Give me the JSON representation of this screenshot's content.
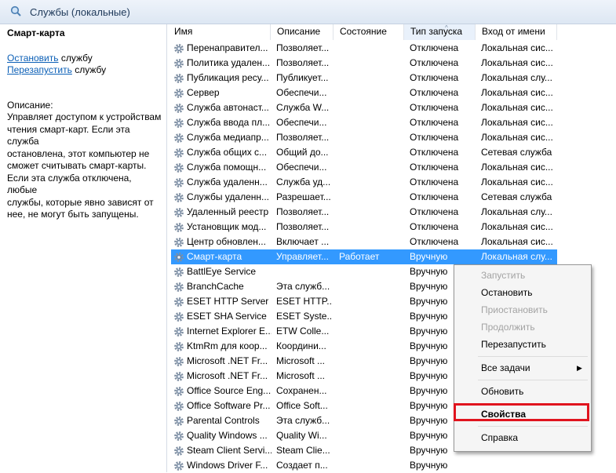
{
  "header": {
    "title": "Службы (локальные)",
    "icon": "services-magnifier-icon"
  },
  "leftpane": {
    "selected_service": "Смарт-карта",
    "stop_link": "Остановить",
    "stop_suffix": "службу",
    "restart_link": "Перезапустить",
    "restart_suffix": "службу",
    "description_label": "Описание:",
    "description_lines": [
      "Управляет доступом к устройствам",
      "чтения смарт-карт. Если эта служба",
      "остановлена, этот компьютер не",
      "сможет считывать смарт-карты.",
      "Если эта служба отключена, любые",
      "службы, которые явно зависят от",
      "нее, не могут быть запущены."
    ]
  },
  "columns": {
    "name": "Имя",
    "description": "Описание",
    "state": "Состояние",
    "startup": "Тип запуска",
    "logon": "Вход от имени"
  },
  "rows": [
    {
      "name": "Перенаправител...",
      "desc": "Позволяет...",
      "state": "",
      "start": "Отключена",
      "logon": "Локальная сис..."
    },
    {
      "name": "Политика удален...",
      "desc": "Позволяет...",
      "state": "",
      "start": "Отключена",
      "logon": "Локальная сис..."
    },
    {
      "name": "Публикация ресу...",
      "desc": "Публикует...",
      "state": "",
      "start": "Отключена",
      "logon": "Локальная слу..."
    },
    {
      "name": "Сервер",
      "desc": "Обеспечи...",
      "state": "",
      "start": "Отключена",
      "logon": "Локальная сис..."
    },
    {
      "name": "Служба автонаст...",
      "desc": "Служба W...",
      "state": "",
      "start": "Отключена",
      "logon": "Локальная сис..."
    },
    {
      "name": "Служба ввода пл...",
      "desc": "Обеспечи...",
      "state": "",
      "start": "Отключена",
      "logon": "Локальная сис..."
    },
    {
      "name": "Служба медиапр...",
      "desc": "Позволяет...",
      "state": "",
      "start": "Отключена",
      "logon": "Локальная сис..."
    },
    {
      "name": "Служба общих с...",
      "desc": "Общий до...",
      "state": "",
      "start": "Отключена",
      "logon": "Сетевая служба"
    },
    {
      "name": "Служба помощн...",
      "desc": "Обеспечи...",
      "state": "",
      "start": "Отключена",
      "logon": "Локальная сис..."
    },
    {
      "name": "Служба удаленн...",
      "desc": "Служба уд...",
      "state": "",
      "start": "Отключена",
      "logon": "Локальная сис..."
    },
    {
      "name": "Службы удаленн...",
      "desc": "Разрешает...",
      "state": "",
      "start": "Отключена",
      "logon": "Сетевая служба"
    },
    {
      "name": "Удаленный реестр",
      "desc": "Позволяет...",
      "state": "",
      "start": "Отключена",
      "logon": "Локальная слу..."
    },
    {
      "name": "Установщик мод...",
      "desc": "Позволяет...",
      "state": "",
      "start": "Отключена",
      "logon": "Локальная сис..."
    },
    {
      "name": "Центр обновлен...",
      "desc": "Включает ...",
      "state": "",
      "start": "Отключена",
      "logon": "Локальная сис..."
    },
    {
      "name": "Смарт-карта",
      "desc": "Управляет...",
      "state": "Работает",
      "start": "Вручную",
      "logon": "Локальная слу...",
      "selected": true
    },
    {
      "name": "BattlEye Service",
      "desc": "",
      "state": "",
      "start": "Вручную",
      "logon": ""
    },
    {
      "name": "BranchCache",
      "desc": "Эта служб...",
      "state": "",
      "start": "Вручную",
      "logon": ""
    },
    {
      "name": "ESET HTTP Server",
      "desc": "ESET HTTP...",
      "state": "",
      "start": "Вручную",
      "logon": ""
    },
    {
      "name": "ESET SHA Service",
      "desc": "ESET Syste...",
      "state": "",
      "start": "Вручную",
      "logon": ""
    },
    {
      "name": "Internet Explorer E...",
      "desc": "ETW Colle...",
      "state": "",
      "start": "Вручную",
      "logon": ""
    },
    {
      "name": "KtmRm для коор...",
      "desc": "Координи...",
      "state": "",
      "start": "Вручную",
      "logon": ""
    },
    {
      "name": "Microsoft .NET Fr...",
      "desc": "Microsoft ...",
      "state": "",
      "start": "Вручную",
      "logon": ""
    },
    {
      "name": "Microsoft .NET Fr...",
      "desc": "Microsoft ...",
      "state": "",
      "start": "Вручную",
      "logon": ""
    },
    {
      "name": "Office  Source Eng...",
      "desc": "Сохранен...",
      "state": "",
      "start": "Вручную",
      "logon": ""
    },
    {
      "name": "Office Software Pr...",
      "desc": "Office Soft...",
      "state": "",
      "start": "Вручную",
      "logon": ""
    },
    {
      "name": "Parental Controls",
      "desc": "Эта служб...",
      "state": "",
      "start": "Вручную",
      "logon": ""
    },
    {
      "name": "Quality Windows ...",
      "desc": "Quality Wi...",
      "state": "",
      "start": "Вручную",
      "logon": ""
    },
    {
      "name": "Steam Client Servi...",
      "desc": "Steam Clie...",
      "state": "",
      "start": "Вручную",
      "logon": ""
    },
    {
      "name": "Windows Driver F...",
      "desc": "Создает п...",
      "state": "",
      "start": "Вручную",
      "logon": ""
    }
  ],
  "context_menu": {
    "start": "Запустить",
    "stop": "Остановить",
    "pause": "Приостановить",
    "resume": "Продолжить",
    "restart": "Перезапустить",
    "all_tasks": "Все задачи",
    "refresh": "Обновить",
    "properties": "Свойства",
    "help": "Справка"
  },
  "colors": {
    "selection": "#3399ff",
    "highlight": "#e0141e",
    "link": "#0b5fb6"
  }
}
